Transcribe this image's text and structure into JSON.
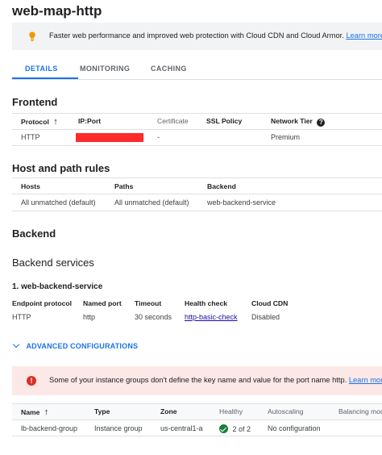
{
  "page": {
    "title": "web-map-http"
  },
  "banner": {
    "text": "Faster web performance and improved web protection with Cloud CDN and Cloud Armor.",
    "link": "Learn more",
    "icon": "lightbulb-icon"
  },
  "tabs": [
    {
      "label": "DETAILS",
      "active": true
    },
    {
      "label": "MONITORING",
      "active": false
    },
    {
      "label": "CACHING",
      "active": false
    }
  ],
  "frontend": {
    "heading": "Frontend",
    "columns": [
      "Protocol",
      "IP:Port",
      "Certificate",
      "SSL Policy",
      "Network Tier"
    ],
    "row": {
      "protocol": "HTTP",
      "ip_port": "",
      "certificate": "-",
      "ssl_policy": "",
      "network_tier": "Premium"
    }
  },
  "host_path": {
    "heading": "Host and path rules",
    "columns": [
      "Hosts",
      "Paths",
      "Backend"
    ],
    "row": {
      "hosts": "All unmatched (default)",
      "paths": "All unmatched (default)",
      "backend": "web-backend-service"
    }
  },
  "backend": {
    "heading": "Backend",
    "services_heading": "Backend services",
    "service_title": "1. web-backend-service",
    "columns": [
      "Endpoint protocol",
      "Named port",
      "Timeout",
      "Health check",
      "Cloud CDN"
    ],
    "row": {
      "endpoint_protocol": "HTTP",
      "named_port": "http",
      "timeout": "30 seconds",
      "health_check": "http-basic-check",
      "cloud_cdn": "Disabled"
    },
    "advanced_label": "ADVANCED CONFIGURATIONS"
  },
  "error_banner": {
    "text": "Some of your instance groups don't define the key name and value for the port name http.",
    "link": "Learn more"
  },
  "groups_table": {
    "columns": [
      "Name",
      "Type",
      "Zone",
      "Healthy",
      "Autoscaling",
      "Balancing mod"
    ],
    "row": {
      "name": "lb-backend-group",
      "type": "Instance group",
      "zone": "us-central1-a",
      "healthy": "2 of 2",
      "autoscaling": "No configuration"
    }
  },
  "colors": {
    "accent": "#1a73e8",
    "error": "#d93025",
    "success": "#188038",
    "redaction": "#ff2a2a"
  }
}
